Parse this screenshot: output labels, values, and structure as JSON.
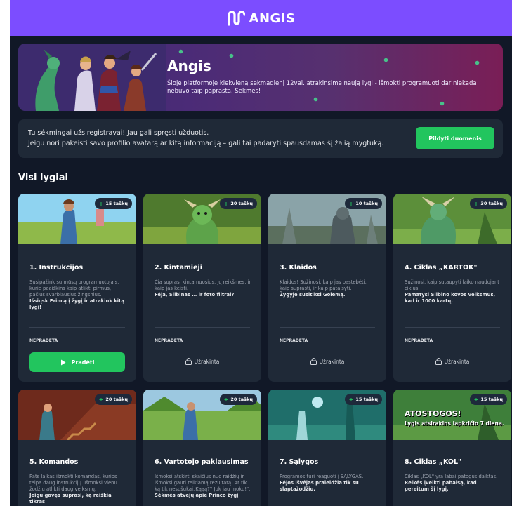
{
  "header": {
    "logo_text": "ANGIS",
    "logo_icon": "angis-snake-logo-icon",
    "bg_color": "#7c4dff"
  },
  "hero": {
    "title": "Angis",
    "text": "Šioje platformoje kiekvieną sekmadienį 12val. atrakinsime naują lygį - išmokti programuoti dar niekada nebuvo taip paprasta. Sėkmės!"
  },
  "notice": {
    "line1": "Tu sėkmingai užsiregistravai! Jau gali spręsti užduotis.",
    "line2": "Jeigu nori pakeisti savo profilio avatarą ar kitą informaciją – gali tai padaryti spausdamas šį žalią mygtuką.",
    "button": "Pildyti duomenis"
  },
  "levels_title": "Visi lygiai",
  "levels": [
    {
      "points": "15 taškų",
      "title": "1. Instrukcijos",
      "desc": "Susipažink su mūsų programuotojais, kurie paaiškins kaip atlikti pirmus, pačius svarbiausius žingsnius.",
      "cta": "Išsiųsk Princą į žygį ir atrakink kitą lygį!",
      "status": "NEPRADĖTA",
      "action": "Pradėti"
    },
    {
      "points": "20 taškų",
      "title": "2. Kintamieji",
      "desc": "Čia suprasi kintamuosius, jų reikšmes, ir kaip jas keisti.",
      "cta": "Fėja, Slibinas … ir foto filtrai?",
      "status": "NEPRADĖTA",
      "action": "Užrakinta"
    },
    {
      "points": "10 taškų",
      "title": "3. Klaidos",
      "desc": "Klaidos! Sužinosi, kaip jas pastebėti, kaip suprasti, ir kaip pataisyti.",
      "cta": "Žygyje susitiksi Golemą.",
      "status": "NEPRADĖTA",
      "action": "Užrakinta"
    },
    {
      "points": "30 taškų",
      "title": "4. Ciklas „KARTOK\"",
      "desc": "Sužinosi, kaip sutaupyti laiko naudojant ciklus.",
      "cta": "Pamatysi Slibino kovos veiksmus, kad ir 1000 kartų.",
      "status": "NEPRADĖTA",
      "action": "Užrakinta"
    },
    {
      "points": "20 taškų",
      "title": "5. Komandos",
      "desc": "Pats laikas išmokti komandas, kurios telpa daug instrukcijų. Išmoksi vienu žodžiu atlikti daug veiksmų.",
      "cta": "Jeigu gavęs suprasi, ką reiškia tikras"
    },
    {
      "points": "20 taškų",
      "title": "6. Vartotojo paklausimas",
      "desc": "Išmoksi atskirti skaičius nuo raidžių ir išmoksi gauti reikiamą rezultatą. Ar tik ką tik nesušukai„Kąąą?? Juk jau moku!\".",
      "cta": "Sėkmės atvejų apie Princo žygį"
    },
    {
      "points": "15 taškų",
      "title": "7. Sąlygos",
      "desc": "Programos turi reaguoti į SĄLYGAS.",
      "cta": "Fėjos išvėjas praleidžia tik su slaptažodžiu."
    },
    {
      "points": "15 taškų",
      "title": "8. Ciklas „KOL\"",
      "desc": "Ciklas „KOL\" yra labai patogus daiktas.",
      "cta": "Reikės įveikti pabaisą, kad pereitum šį lygį.",
      "banner_title": "ATOSTOGOS!",
      "banner_sub": "Lygis atsirakins lapkričio 7 dieną."
    }
  ],
  "colors": {
    "accent_green": "#22c55e",
    "page_bg": "#111827",
    "card_bg": "#1f2937"
  }
}
